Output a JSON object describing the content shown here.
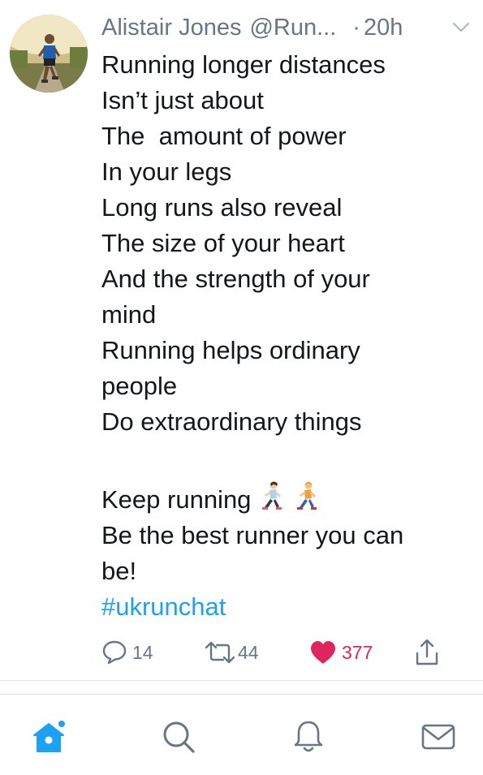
{
  "tweet": {
    "author_name": "Alistair Jones",
    "handle_truncated": "@Run...",
    "separator": "·",
    "time": "20h",
    "lines": [
      "Running longer distances",
      "Isn’t just about",
      "The  amount of power",
      "In your legs",
      "Long runs also reveal",
      "The size of your heart",
      "And the strength of your",
      "mind",
      "Running helps ordinary",
      "people",
      "Do extraordinary things"
    ],
    "closing_line_1": "Keep running",
    "closing_line_2a": "Be the best runner you can",
    "closing_line_2b": "be!",
    "hashtag": "#ukrunchat",
    "emoji": [
      "woman-running-emoji",
      "man-running-emoji"
    ]
  },
  "actions": {
    "reply_count": "14",
    "retweet_count": "44",
    "like_count": "377"
  },
  "colors": {
    "text": "#14171a",
    "muted": "#657786",
    "link": "#1da1f2",
    "like": "#e0245e"
  },
  "tabbar": {
    "items": [
      "home-icon",
      "search-icon",
      "notifications-icon",
      "messages-icon"
    ]
  }
}
